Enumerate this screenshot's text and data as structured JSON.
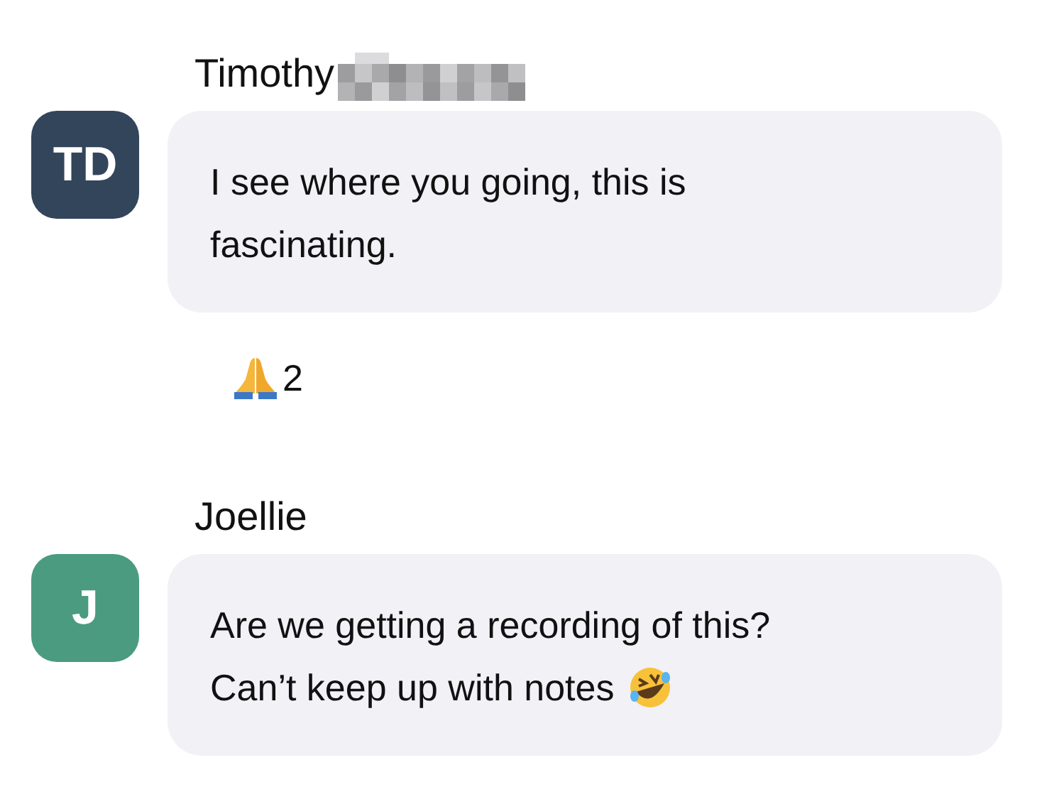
{
  "messages": [
    {
      "sender": "Timothy",
      "name_redacted": true,
      "avatar": {
        "initials": "TD",
        "color": "#33455b"
      },
      "lines": [
        "I see where you going, this is",
        "fascinating."
      ],
      "has_emoji": false,
      "reactions": [
        {
          "count": "2"
        }
      ]
    },
    {
      "sender": "Joellie",
      "name_redacted": false,
      "avatar": {
        "initials": "J",
        "color": "#4a9b80"
      },
      "lines": [
        "Are we getting a recording of this?",
        "Can’t keep up with notes"
      ],
      "has_emoji": true
    }
  ]
}
